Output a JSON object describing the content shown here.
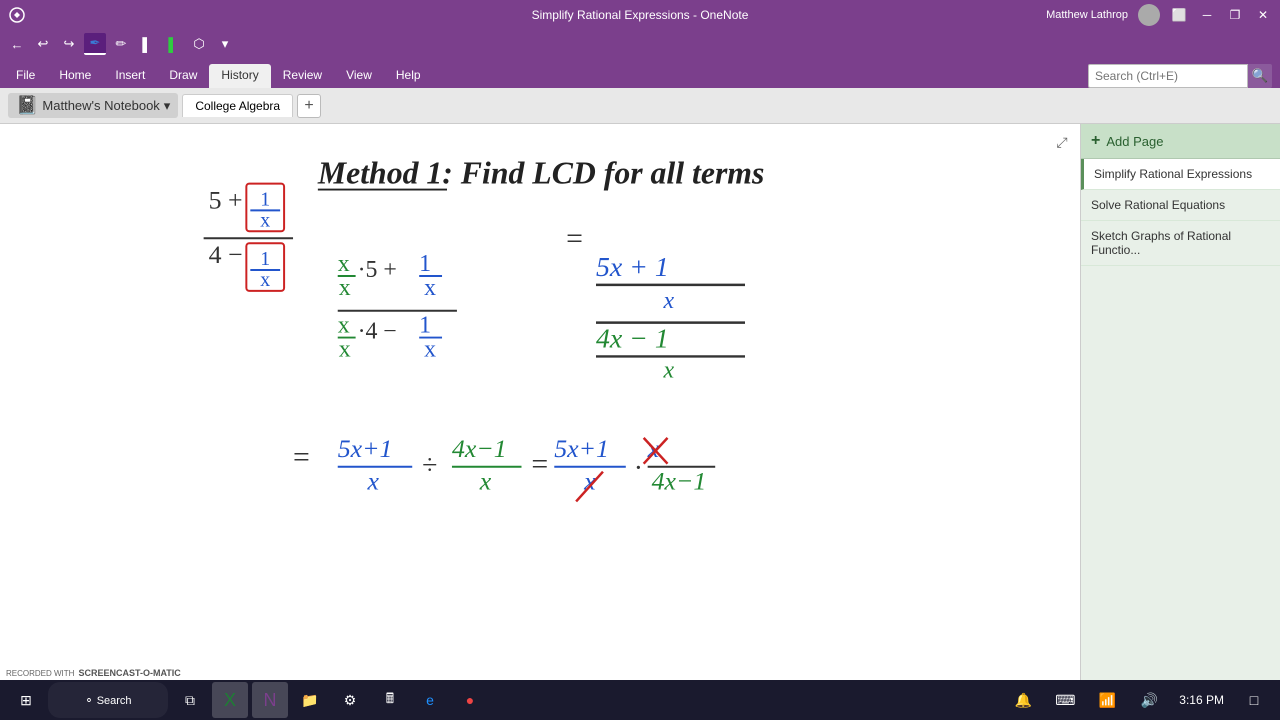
{
  "app": {
    "title": "Simplify Rational Expressions - OneNote",
    "user": "Matthew Lathrop"
  },
  "qat": {
    "buttons": [
      "↩",
      "↪",
      "✏",
      "✒",
      "✏",
      "A",
      "↓"
    ]
  },
  "ribbon": {
    "tabs": [
      "File",
      "Home",
      "Insert",
      "Draw",
      "History",
      "Review",
      "View",
      "Help"
    ],
    "active_tab": "History"
  },
  "notebook": {
    "name": "Matthew's Notebook",
    "active_section": "College Algebra"
  },
  "search": {
    "placeholder": "Search (Ctrl+E)"
  },
  "pages": {
    "add_label": "Add Page",
    "items": [
      {
        "label": "Simplify Rational Expressions",
        "active": true
      },
      {
        "label": "Solve Rational Equations",
        "active": false
      },
      {
        "label": "Sketch Graphs of Rational Functio...",
        "active": false
      }
    ]
  },
  "taskbar": {
    "time": "3:16 PM"
  }
}
